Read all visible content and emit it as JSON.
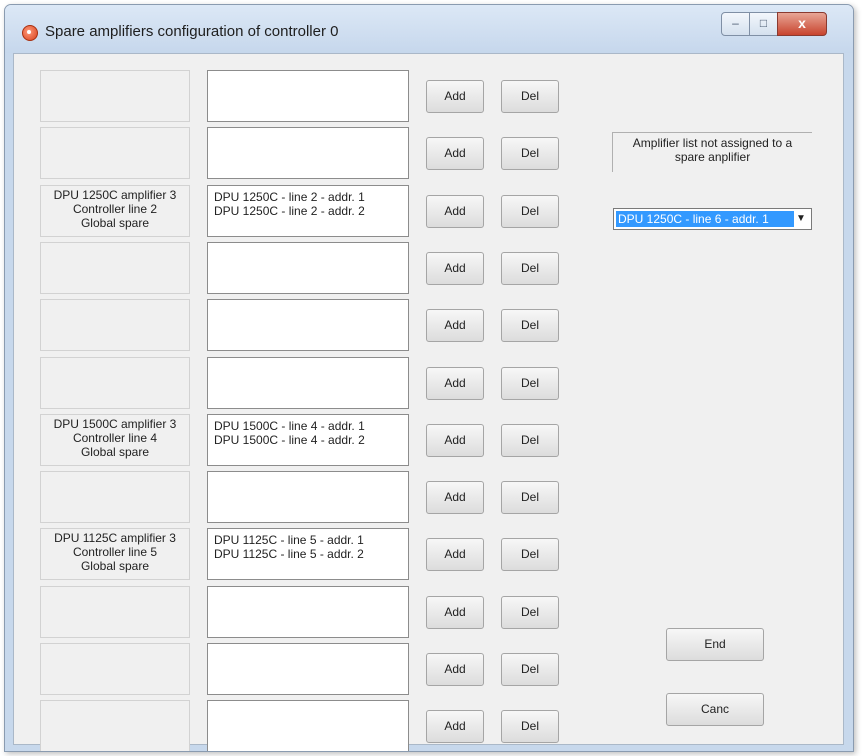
{
  "window": {
    "title": "Spare amplifiers configuration of controller 0",
    "controls": {
      "minimize": "–",
      "maximize": "□",
      "close": "x"
    }
  },
  "rows": [
    {
      "label_lines": [
        "",
        "",
        ""
      ],
      "entries": [
        "",
        ""
      ],
      "add": "Add",
      "del": "Del"
    },
    {
      "label_lines": [
        "",
        "",
        ""
      ],
      "entries": [
        "",
        ""
      ],
      "add": "Add",
      "del": "Del"
    },
    {
      "label_lines": [
        "DPU 1250C amplifier 3",
        "Controller line 2",
        "Global spare"
      ],
      "entries": [
        "DPU 1250C - line 2 - addr. 1",
        "DPU 1250C - line 2 - addr. 2"
      ],
      "add": "Add",
      "del": "Del"
    },
    {
      "label_lines": [
        "",
        "",
        ""
      ],
      "entries": [
        "",
        ""
      ],
      "add": "Add",
      "del": "Del"
    },
    {
      "label_lines": [
        "",
        "",
        ""
      ],
      "entries": [
        "",
        ""
      ],
      "add": "Add",
      "del": "Del"
    },
    {
      "label_lines": [
        "",
        "",
        ""
      ],
      "entries": [
        "",
        ""
      ],
      "add": "Add",
      "del": "Del"
    },
    {
      "label_lines": [
        "DPU 1500C amplifier 3",
        "Controller line 4",
        "Global spare"
      ],
      "entries": [
        "DPU 1500C - line 4 - addr. 1",
        "DPU 1500C - line 4 - addr. 2"
      ],
      "add": "Add",
      "del": "Del"
    },
    {
      "label_lines": [
        "",
        "",
        ""
      ],
      "entries": [
        "",
        ""
      ],
      "add": "Add",
      "del": "Del"
    },
    {
      "label_lines": [
        "DPU 1125C amplifier 3",
        "Controller line 5",
        "Global spare"
      ],
      "entries": [
        "DPU 1125C - line 5 - addr. 1",
        "DPU 1125C - line 5 - addr. 2"
      ],
      "add": "Add",
      "del": "Del"
    },
    {
      "label_lines": [
        "",
        "",
        ""
      ],
      "entries": [
        "",
        ""
      ],
      "add": "Add",
      "del": "Del"
    },
    {
      "label_lines": [
        "",
        "",
        ""
      ],
      "entries": [
        "",
        ""
      ],
      "add": "Add",
      "del": "Del"
    },
    {
      "label_lines": [
        "",
        "",
        ""
      ],
      "entries": [
        "",
        ""
      ],
      "add": "Add",
      "del": "Del"
    }
  ],
  "right_panel": {
    "info_line1": "Amplifier list not assigned to a",
    "info_line2": "spare anplifier",
    "combo_value": "DPU 1250C - line 6 - addr. 1",
    "end_label": "End",
    "cancel_label": "Canc"
  }
}
